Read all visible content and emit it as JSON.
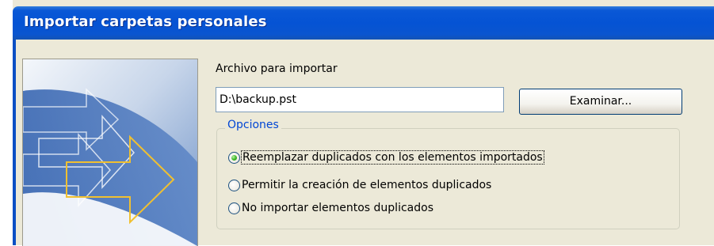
{
  "window": {
    "title": "Importar carpetas personales"
  },
  "form": {
    "file_label": "Archivo para importar",
    "file_value": "D:\\backup.pst",
    "browse_label": "Examinar..."
  },
  "options": {
    "legend": "Opciones",
    "items": [
      {
        "label": "Reemplazar duplicados con los elementos importados",
        "checked": true
      },
      {
        "label": "Permitir la creación de elementos duplicados",
        "checked": false
      },
      {
        "label": "No importar elementos duplicados",
        "checked": false
      }
    ]
  },
  "colors": {
    "titlebar": "#0553d4",
    "dialog_bg": "#ece9d8",
    "group_legend": "#0046d5",
    "art_arrow": "#f0c030"
  },
  "icons": {
    "wizard_art": "import-arrows-illustration"
  }
}
